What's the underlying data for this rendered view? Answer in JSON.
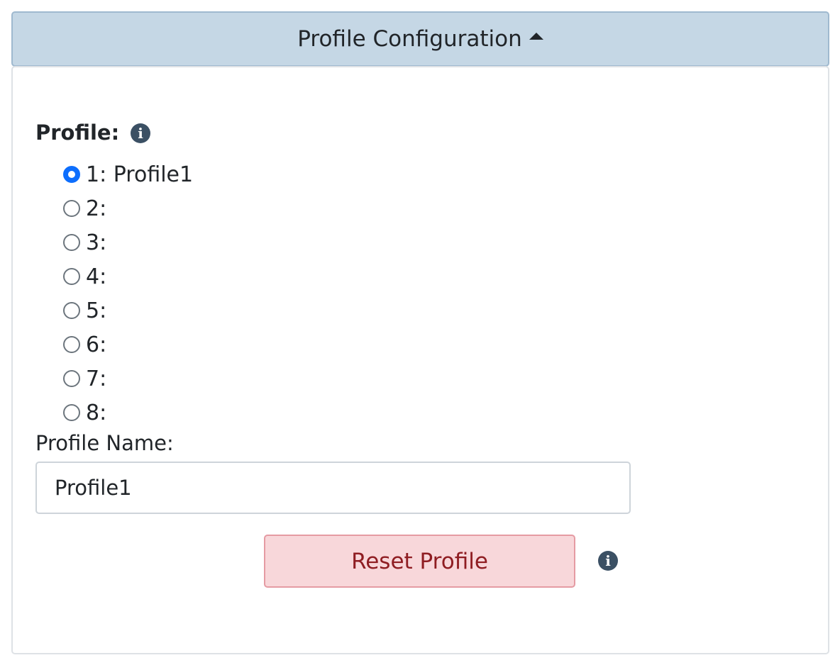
{
  "header": {
    "title": "Profile Configuration"
  },
  "profile": {
    "label": "Profile:",
    "selected": 1,
    "options": [
      {
        "label": "1: Profile1",
        "checked": true
      },
      {
        "label": "2:",
        "checked": false
      },
      {
        "label": "3:",
        "checked": false
      },
      {
        "label": "4:",
        "checked": false
      },
      {
        "label": "5:",
        "checked": false
      },
      {
        "label": "6:",
        "checked": false
      },
      {
        "label": "7:",
        "checked": false
      },
      {
        "label": "8:",
        "checked": false
      }
    ]
  },
  "profile_name": {
    "label": "Profile Name:",
    "value": "Profile1"
  },
  "reset_button": {
    "label": "Reset Profile"
  },
  "icons": {
    "info": "info-circle-icon",
    "caret": "caret-up-icon",
    "info_glyph": "i"
  },
  "colors": {
    "header_bg": "#c5d7e5",
    "radio_checked": "#0d6efd",
    "danger_bg": "#f8d7da",
    "danger_text": "#8f1d22",
    "info_icon": "#3b5064"
  }
}
